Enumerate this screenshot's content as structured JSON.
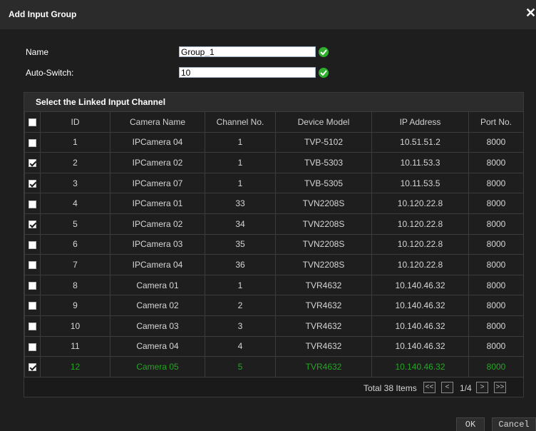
{
  "dialog": {
    "title": "Add Input Group",
    "close_symbol": "✕"
  },
  "form": {
    "name_label": "Name",
    "name_value": "Group_1",
    "autoswitch_label": "Auto-Switch:",
    "autoswitch_value": "10"
  },
  "panel": {
    "title": "Select the Linked Input Channel"
  },
  "table": {
    "columns": [
      "ID",
      "Camera Name",
      "Channel No.",
      "Device Model",
      "IP Address",
      "Port No."
    ],
    "rows": [
      {
        "checked": false,
        "id": "1",
        "camera": "IPCamera 04",
        "channel": "1",
        "model": "TVP-5102",
        "ip": "10.51.51.2",
        "port": "8000",
        "highlight": false
      },
      {
        "checked": true,
        "id": "2",
        "camera": "IPCamera 02",
        "channel": "1",
        "model": "TVB-5303",
        "ip": "10.11.53.3",
        "port": "8000",
        "highlight": false
      },
      {
        "checked": true,
        "id": "3",
        "camera": "IPCamera 07",
        "channel": "1",
        "model": "TVB-5305",
        "ip": "10.11.53.5",
        "port": "8000",
        "highlight": false
      },
      {
        "checked": false,
        "id": "4",
        "camera": "IPCamera 01",
        "channel": "33",
        "model": "TVN2208S",
        "ip": "10.120.22.8",
        "port": "8000",
        "highlight": false
      },
      {
        "checked": true,
        "id": "5",
        "camera": "IPCamera 02",
        "channel": "34",
        "model": "TVN2208S",
        "ip": "10.120.22.8",
        "port": "8000",
        "highlight": false
      },
      {
        "checked": false,
        "id": "6",
        "camera": "IPCamera 03",
        "channel": "35",
        "model": "TVN2208S",
        "ip": "10.120.22.8",
        "port": "8000",
        "highlight": false
      },
      {
        "checked": false,
        "id": "7",
        "camera": "IPCamera 04",
        "channel": "36",
        "model": "TVN2208S",
        "ip": "10.120.22.8",
        "port": "8000",
        "highlight": false
      },
      {
        "checked": false,
        "id": "8",
        "camera": "Camera 01",
        "channel": "1",
        "model": "TVR4632",
        "ip": "10.140.46.32",
        "port": "8000",
        "highlight": false
      },
      {
        "checked": false,
        "id": "9",
        "camera": "Camera 02",
        "channel": "2",
        "model": "TVR4632",
        "ip": "10.140.46.32",
        "port": "8000",
        "highlight": false
      },
      {
        "checked": false,
        "id": "10",
        "camera": "Camera 03",
        "channel": "3",
        "model": "TVR4632",
        "ip": "10.140.46.32",
        "port": "8000",
        "highlight": false
      },
      {
        "checked": false,
        "id": "11",
        "camera": "Camera 04",
        "channel": "4",
        "model": "TVR4632",
        "ip": "10.140.46.32",
        "port": "8000",
        "highlight": false
      },
      {
        "checked": true,
        "id": "12",
        "camera": "Camera 05",
        "channel": "5",
        "model": "TVR4632",
        "ip": "10.140.46.32",
        "port": "8000",
        "highlight": true
      }
    ]
  },
  "pager": {
    "total": "Total 38 Items",
    "first": "<<",
    "prev": "<",
    "page": "1/4",
    "next": ">",
    "last": ">>"
  },
  "buttons": {
    "ok": "OK",
    "cancel": "Cancel"
  },
  "colors": {
    "accent_green": "#24a524",
    "status_icon": "#2eb02e",
    "background": "#1e1e1e"
  },
  "icons": {
    "status": "check-circle-icon",
    "close": "close-icon"
  }
}
